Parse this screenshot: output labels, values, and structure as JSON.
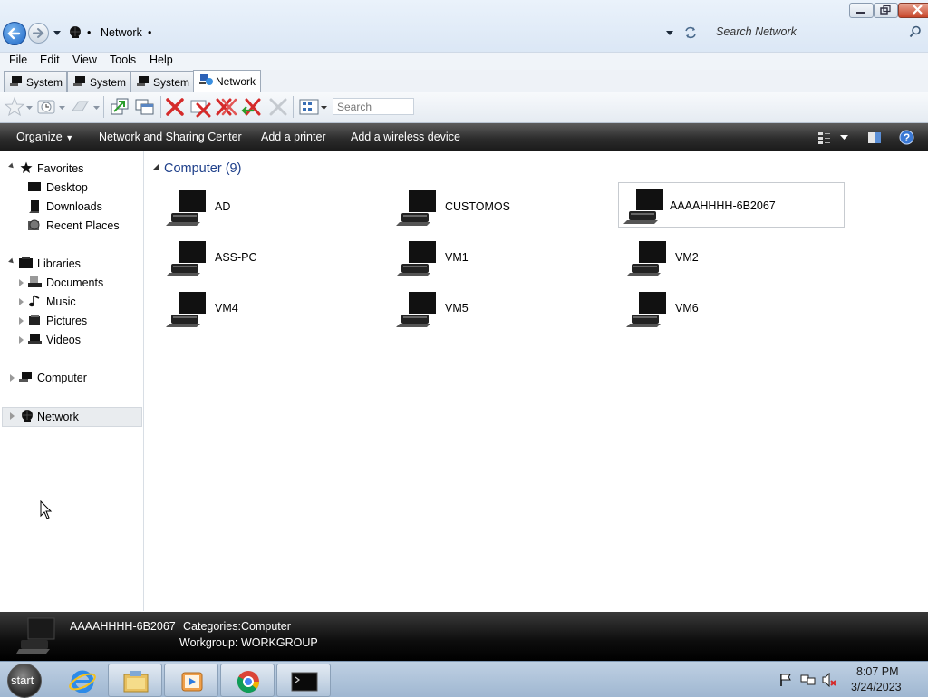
{
  "window": {
    "breadcrumb": "Network",
    "search_placeholder": "Search Network"
  },
  "menu": [
    "File",
    "Edit",
    "View",
    "Tools",
    "Help"
  ],
  "tabs": [
    {
      "label": "System"
    },
    {
      "label": "System"
    },
    {
      "label": "System"
    },
    {
      "label": "Network"
    }
  ],
  "toolbar": {
    "search_placeholder": "Search"
  },
  "commands": {
    "organize": "Organize",
    "network_sharing": "Network and Sharing Center",
    "add_printer": "Add a printer",
    "add_wireless": "Add a wireless device"
  },
  "nav": {
    "favorites": "Favorites",
    "desktop": "Desktop",
    "downloads": "Downloads",
    "recent": "Recent Places",
    "libraries": "Libraries",
    "documents": "Documents",
    "music": "Music",
    "pictures": "Pictures",
    "videos": "Videos",
    "computer": "Computer",
    "network": "Network"
  },
  "content": {
    "group_header": "Computer (9)",
    "items": [
      "AD",
      "CUSTOMOS",
      "AAAAHHHH-6B2067",
      "ASS-PC",
      "VM1",
      "VM2",
      "VM4",
      "VM5",
      "VM6"
    ]
  },
  "details": {
    "name": "AAAAHHHH-6B2067",
    "categories_label": "Categories:",
    "categories_value": "Computer",
    "workgroup_label": "Workgroup:",
    "workgroup_value": "WORKGROUP"
  },
  "taskbar": {
    "start": "start",
    "time": "8:07 PM",
    "date": "3/24/2023"
  },
  "colors": {
    "accent_blue": "#1b65c6",
    "group_header": "#1e3f8a",
    "command_bar": "#2c2c2c"
  }
}
